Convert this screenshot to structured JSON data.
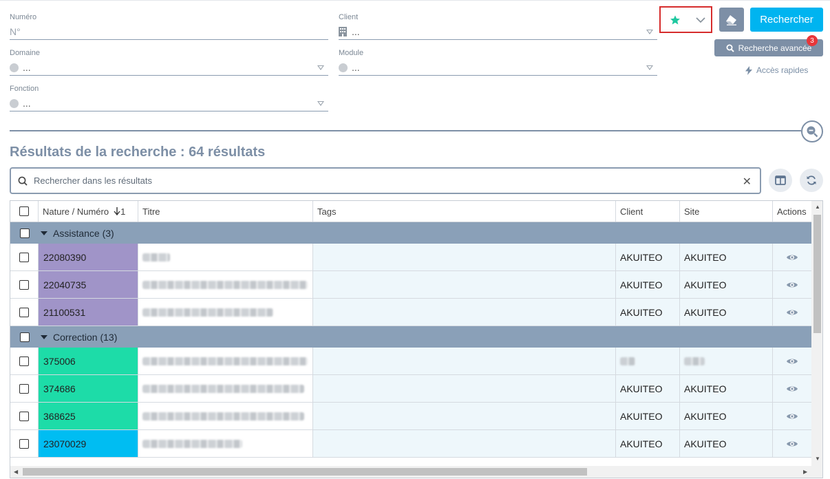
{
  "form": {
    "numero": {
      "label": "Numéro",
      "placeholder": "N°"
    },
    "client": {
      "label": "Client",
      "value": "..."
    },
    "domaine": {
      "label": "Domaine",
      "value": "..."
    },
    "module": {
      "label": "Module",
      "value": "..."
    },
    "fonction": {
      "label": "Fonction",
      "value": "..."
    }
  },
  "toolbar": {
    "search_label": "Rechercher",
    "advanced_label": "Recherche avancée",
    "advanced_badge": "3",
    "quick_access_label": "Accès rapides"
  },
  "results": {
    "title": "Résultats de la recherche : 64 résultats",
    "search_placeholder": "Rechercher dans les résultats"
  },
  "table": {
    "columns": [
      "Nature / Numéro",
      "Titre",
      "Tags",
      "Client",
      "Site",
      "Actions"
    ],
    "sort_indicator": "1",
    "groups": [
      {
        "label": "Assistance (3)",
        "color": "#a094c8",
        "rows": [
          {
            "numero": "22080390",
            "client": "AKUITEO",
            "site": "AKUITEO"
          },
          {
            "numero": "22040735",
            "client": "AKUITEO",
            "site": "AKUITEO"
          },
          {
            "numero": "21100531",
            "client": "AKUITEO",
            "site": "AKUITEO"
          }
        ]
      },
      {
        "label": "Correction (13)",
        "color": "#1ddca8",
        "rows": [
          {
            "numero": "375006",
            "client": "",
            "site": ""
          },
          {
            "numero": "374686",
            "client": "AKUITEO",
            "site": "AKUITEO"
          },
          {
            "numero": "368625",
            "client": "AKUITEO",
            "site": "AKUITEO"
          },
          {
            "numero": "23070029",
            "client": "AKUITEO",
            "site": "AKUITEO",
            "color": "#00bdf2"
          }
        ]
      }
    ]
  },
  "colors": {
    "accent": "#00b4f0",
    "slate": "#7d8fa6",
    "favorite_star": "#1fc8a0",
    "badge": "#e8363a",
    "highlight_border": "#d62c2c"
  }
}
